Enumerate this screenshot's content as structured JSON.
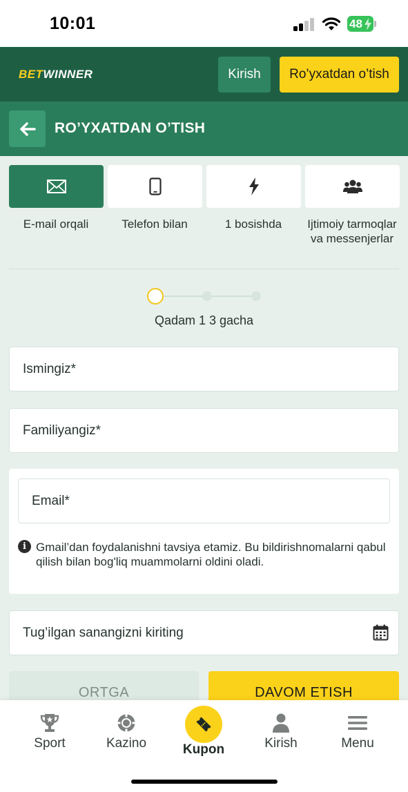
{
  "status_bar": {
    "time": "10:01",
    "battery": "48"
  },
  "header": {
    "logo_part1": "BET",
    "logo_part2": "WINNER",
    "login_label": "Kirish",
    "register_label": "Ro’yxatdan o’tish"
  },
  "page": {
    "title": "RO’YXATDAN O’TISH"
  },
  "methods": [
    {
      "label": "E-mail orqali",
      "icon": "envelope-icon",
      "active": true
    },
    {
      "label": "Telefon bilan",
      "icon": "phone-icon",
      "active": false
    },
    {
      "label": "1 bosishda",
      "icon": "lightning-icon",
      "active": false
    },
    {
      "label": "Ijtimoiy tarmoqlar va messenjerlar",
      "icon": "people-icon",
      "active": false
    }
  ],
  "stepper": {
    "text": "Qadam 1 3 gacha",
    "current_step": 1,
    "total_steps": 3
  },
  "form": {
    "first_name_placeholder": "Ismingiz*",
    "last_name_placeholder": "Familiyangiz*",
    "email_placeholder": "Email*",
    "email_hint": "Gmail’dan foydalanishni tavsiya etamiz. Bu bildirishnomalarni qabul qilish bilan bog'liq muammolarni oldini oladi.",
    "birthdate_placeholder": "Tug’ilgan sanangizni kiriting"
  },
  "actions": {
    "back_label": "ORTGA",
    "continue_label": "DAVOM ETISH"
  },
  "bottom_nav": [
    {
      "label": "Sport",
      "icon": "trophy-icon"
    },
    {
      "label": "Kazino",
      "icon": "casino-chip-icon"
    },
    {
      "label": "Kupon",
      "icon": "ticket-icon"
    },
    {
      "label": "Kirish",
      "icon": "user-icon"
    },
    {
      "label": "Menu",
      "icon": "hamburger-icon"
    }
  ],
  "colors": {
    "brand_dark_green": "#1e5f44",
    "brand_green": "#2a7d5a",
    "accent_yellow": "#fbd21a",
    "background": "#e8f0ec"
  }
}
